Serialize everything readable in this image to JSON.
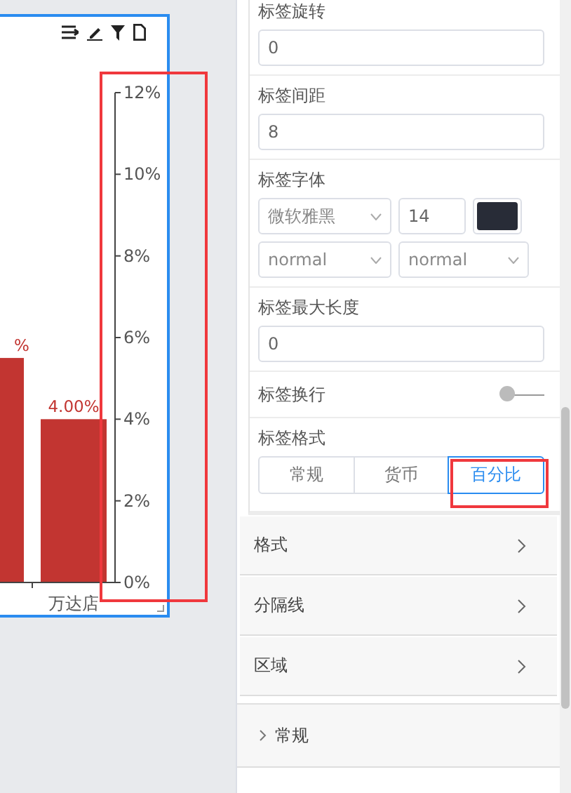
{
  "chart": {
    "chart_data": {
      "type": "bar",
      "categories": [
        null,
        "万达店"
      ],
      "series": [
        {
          "color": "#c23531",
          "values": [
            5.5,
            4.0
          ]
        }
      ],
      "ylim": [
        0,
        12
      ],
      "yticks": [
        {
          "value": 0,
          "label": "0%"
        },
        {
          "value": 2,
          "label": "2%"
        },
        {
          "value": 4,
          "label": "4%"
        },
        {
          "value": 6,
          "label": "6%"
        },
        {
          "value": 8,
          "label": "8%"
        },
        {
          "value": 10,
          "label": "10%"
        },
        {
          "value": 12,
          "label": "12%"
        }
      ],
      "value_labels": [
        "%",
        "4.00%"
      ]
    }
  },
  "settings": {
    "items": [
      {
        "kind": "input",
        "label": "标签旋转",
        "value": "0"
      },
      {
        "kind": "input",
        "label": "标签间距",
        "value": "8"
      },
      {
        "kind": "font",
        "label": "标签字体",
        "family": "微软雅黑",
        "size": "14",
        "color": "#282c37",
        "weight": "normal",
        "style": "normal"
      },
      {
        "kind": "input",
        "label": "标签最大长度",
        "value": "0"
      },
      {
        "kind": "toggle",
        "label": "标签换行",
        "on": false
      },
      {
        "kind": "segmented",
        "label": "标签格式",
        "options": [
          {
            "label": "常规",
            "selected": false
          },
          {
            "label": "货币",
            "selected": false
          },
          {
            "label": "百分比",
            "selected": true
          }
        ]
      }
    ],
    "sections": [
      {
        "label": "格式",
        "expanded": false
      },
      {
        "label": "分隔线",
        "expanded": false
      },
      {
        "label": "区域",
        "expanded": false
      }
    ],
    "groups": [
      {
        "label": "常规",
        "expanded": false
      }
    ]
  }
}
